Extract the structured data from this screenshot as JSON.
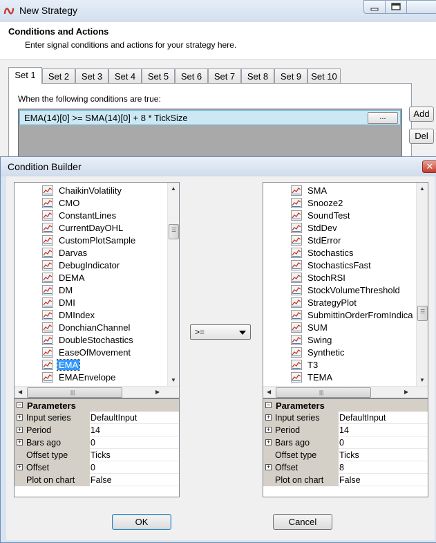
{
  "outer_window": {
    "title": "New Strategy"
  },
  "header": {
    "title": "Conditions and Actions",
    "subtitle": "Enter signal conditions and actions for your strategy here."
  },
  "tabs": [
    "Set 1",
    "Set 2",
    "Set 3",
    "Set 4",
    "Set 5",
    "Set 6",
    "Set 7",
    "Set 8",
    "Set 9",
    "Set 10"
  ],
  "conditions": {
    "label": "When the following conditions are true:",
    "rows": [
      "EMA(14)[0] >= SMA(14)[0] + 8 * TickSize"
    ],
    "ellipsis_label": "...",
    "add_label": "Add",
    "del_label": "Del"
  },
  "builder": {
    "title": "Condition Builder",
    "left_list": [
      "ChaikinVolatility",
      "CMO",
      "ConstantLines",
      "CurrentDayOHL",
      "CustomPlotSample",
      "Darvas",
      "DebugIndicator",
      "DEMA",
      "DM",
      "DMI",
      "DMIndex",
      "DonchianChannel",
      "DoubleStochastics",
      "EaseOfMovement",
      "EMA",
      "EMAEnvelope"
    ],
    "left_selected": "EMA",
    "right_list": [
      "SMA",
      "Snooze2",
      "SoundTest",
      "StdDev",
      "StdError",
      "Stochastics",
      "StochasticsFast",
      "StochRSI",
      "StockVolumeThreshold",
      "StrategyPlot",
      "SubmittinOrderFromIndica",
      "SUM",
      "Swing",
      "Synthetic",
      "T3",
      "TEMA"
    ],
    "operator": ">=",
    "params_header": "Parameters",
    "left_params": [
      {
        "name": "Input series",
        "value": "DefaultInput",
        "expandable": true
      },
      {
        "name": "Period",
        "value": "14",
        "expandable": true
      },
      {
        "name": "Bars ago",
        "value": "0",
        "expandable": true
      },
      {
        "name": "Offset type",
        "value": "Ticks",
        "expandable": false
      },
      {
        "name": "Offset",
        "value": "0",
        "expandable": true
      },
      {
        "name": "Plot on chart",
        "value": "False",
        "expandable": false
      }
    ],
    "right_params": [
      {
        "name": "Input series",
        "value": "DefaultInput",
        "expandable": true
      },
      {
        "name": "Period",
        "value": "14",
        "expandable": true
      },
      {
        "name": "Bars ago",
        "value": "0",
        "expandable": true
      },
      {
        "name": "Offset type",
        "value": "Ticks",
        "expandable": false
      },
      {
        "name": "Offset",
        "value": "8",
        "expandable": true
      },
      {
        "name": "Plot on chart",
        "value": "False",
        "expandable": false
      }
    ],
    "ok_label": "OK",
    "cancel_label": "Cancel",
    "close_glyph": "✕"
  },
  "colors": {
    "selection": "#3399ff",
    "condition_row": "#cce8f4",
    "indicator_icon": "#c0392b"
  }
}
